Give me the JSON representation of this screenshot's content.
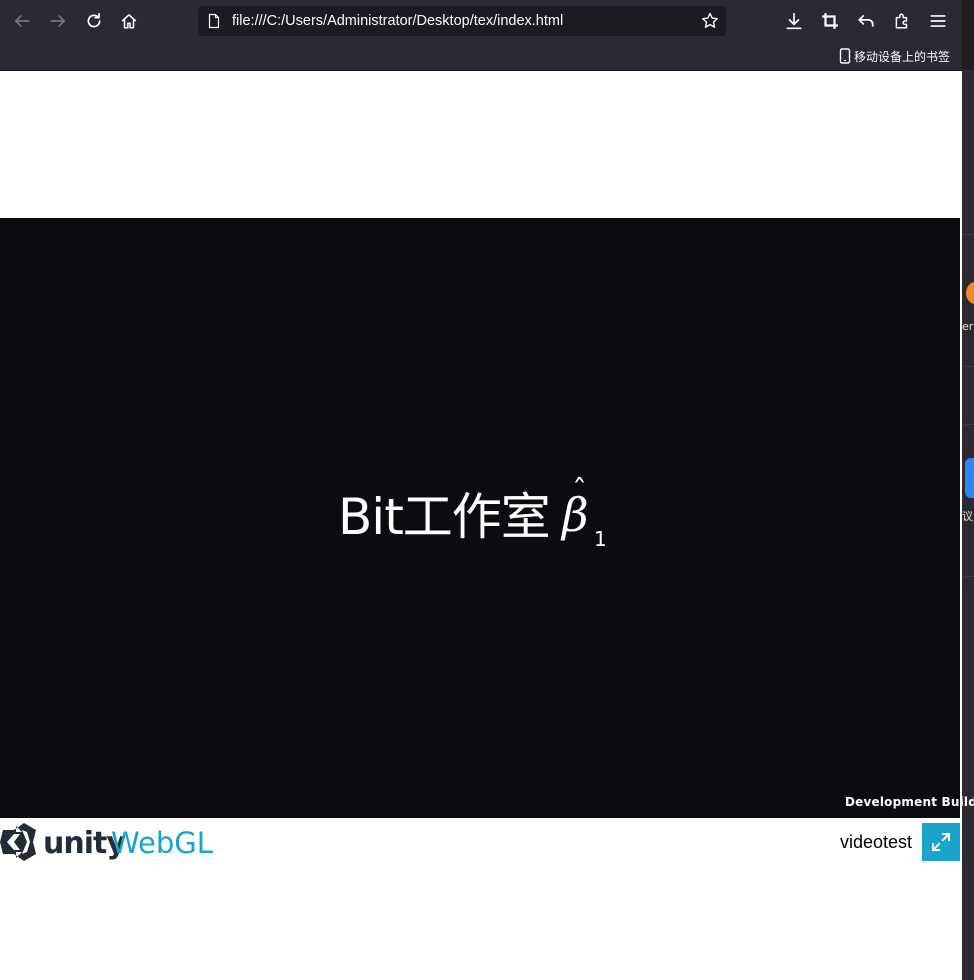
{
  "browser": {
    "url": "file:///C:/Users/Administrator/Desktop/tex/index.html",
    "bookmarks": [
      {
        "label": "移动设备上的书签",
        "icon": "mobile-device-icon"
      }
    ]
  },
  "unity": {
    "canvas_title": "Bit工作室",
    "math_symbol": "β",
    "math_accent": "ˆ",
    "math_subscript": "1",
    "dev_build_label": "Development Build",
    "logo_word_1": "unity",
    "logo_word_2": "WebGL",
    "game_title": "videotest",
    "fullscreen_icon": "fullscreen-icon"
  },
  "background_window": {
    "text_1": "er",
    "text_2": "议"
  },
  "colors": {
    "chrome_bg": "#2b2a33",
    "canvas_bg": "#0b0c0f",
    "accent": "#1aa3cc",
    "unity_dark": "#222c37"
  }
}
